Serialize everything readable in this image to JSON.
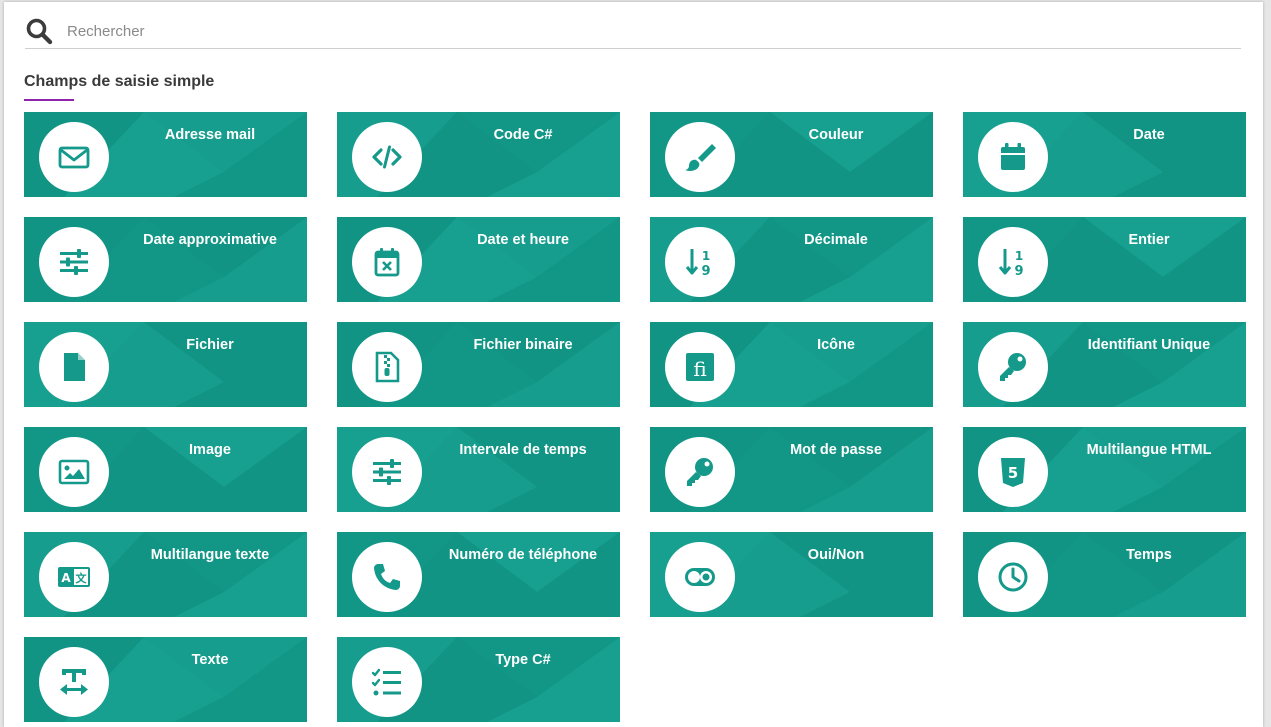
{
  "search": {
    "placeholder": "Rechercher",
    "value": ""
  },
  "section": {
    "title": "Champs de saisie simple"
  },
  "colors": {
    "tile": "#14998a",
    "accent": "#8e24aa",
    "icon": "#14998a"
  },
  "tiles": [
    {
      "label": "Adresse mail",
      "icon": "envelope-icon"
    },
    {
      "label": "Code C#",
      "icon": "code-icon"
    },
    {
      "label": "Couleur",
      "icon": "paint-brush-icon"
    },
    {
      "label": "Date",
      "icon": "calendar-icon"
    },
    {
      "label": "Date approximative",
      "icon": "sliders-icon"
    },
    {
      "label": "Date et heure",
      "icon": "calendar-times-icon"
    },
    {
      "label": "Décimale",
      "icon": "sort-numeric-down-icon"
    },
    {
      "label": "Entier",
      "icon": "sort-numeric-down-icon"
    },
    {
      "label": "Fichier",
      "icon": "file-icon"
    },
    {
      "label": "Fichier binaire",
      "icon": "file-archive-icon"
    },
    {
      "label": "Icône",
      "icon": "font-ligature-icon"
    },
    {
      "label": "Identifiant Unique",
      "icon": "key-icon"
    },
    {
      "label": "Image",
      "icon": "image-icon"
    },
    {
      "label": "Intervale de temps",
      "icon": "sliders-icon"
    },
    {
      "label": "Mot de passe",
      "icon": "key-icon"
    },
    {
      "label": "Multilangue HTML",
      "icon": "html5-icon"
    },
    {
      "label": "Multilangue texte",
      "icon": "language-icon"
    },
    {
      "label": "Numéro de téléphone",
      "icon": "phone-icon"
    },
    {
      "label": "Oui/Non",
      "icon": "toggle-icon"
    },
    {
      "label": "Temps",
      "icon": "clock-icon"
    },
    {
      "label": "Texte",
      "icon": "text-width-icon"
    },
    {
      "label": "Type C#",
      "icon": "tasks-list-icon"
    }
  ]
}
